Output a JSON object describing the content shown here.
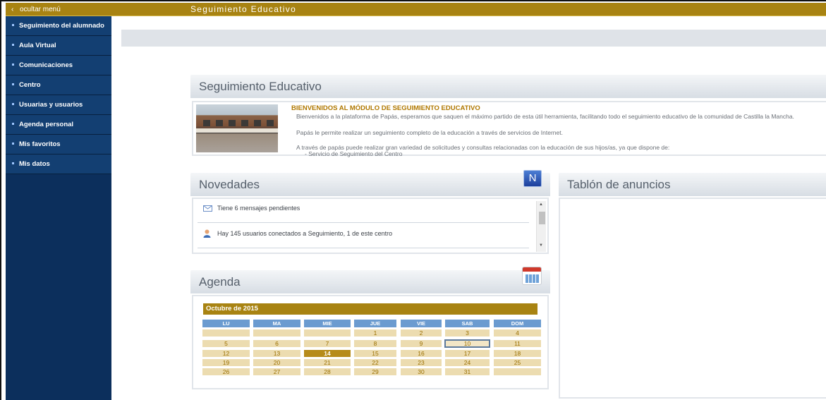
{
  "topbar": {
    "hide_menu_label": "ocultar menú",
    "app_title": "Seguimiento Educativo"
  },
  "sidebar": {
    "items": [
      {
        "label": "Seguimiento del alumnado"
      },
      {
        "label": "Aula Virtual"
      },
      {
        "label": "Comunicaciones"
      },
      {
        "label": "Centro"
      },
      {
        "label": "Usuarias y usuarios"
      },
      {
        "label": "Agenda personal"
      },
      {
        "label": "Mis favoritos"
      },
      {
        "label": "Mis datos"
      }
    ]
  },
  "welcome": {
    "title": "Seguimiento Educativo",
    "heading": "BIENVENIDOS AL MÓDULO DE SEGUIMIENTO EDUCATIVO",
    "p1": "Bienvenidos a la plataforma de Papás, esperamos que saquen el máximo partido de esta útil herramienta, facilitando todo el seguimiento educativo de la comunidad de Castilla la Mancha.",
    "p2": "Papás le permite realizar un seguimiento completo de la educación a través de servicios de Internet.",
    "p3": "A través de papás puede realizar gran variedad de solicitudes y consultas relacionadas con la educación de sus hijos/as, ya que dispone de:",
    "p4": "- Servicio de Seguimiento del Centro"
  },
  "novedades": {
    "title": "Novedades",
    "badge": "N",
    "messages": "Tiene 6 mensajes pendientes",
    "users": "Hay 145 usuarios conectados a Seguimiento, 1 de este centro"
  },
  "tablon": {
    "title": "Tablón de anuncios"
  },
  "agenda": {
    "title": "Agenda",
    "month": "Octubre de 2015",
    "day_headers": [
      "LU",
      "MA",
      "MIE",
      "JUE",
      "VIE",
      "SAB",
      "DOM"
    ],
    "weeks": [
      [
        "",
        "",
        "",
        "1",
        "2",
        "3",
        "4"
      ],
      [
        "5",
        "6",
        "7",
        "8",
        "9",
        "10",
        "11"
      ],
      [
        "12",
        "13",
        "14",
        "15",
        "16",
        "17",
        "18"
      ],
      [
        "19",
        "20",
        "21",
        "22",
        "23",
        "24",
        "25"
      ],
      [
        "26",
        "27",
        "28",
        "29",
        "30",
        "31",
        ""
      ]
    ],
    "today": "14",
    "selected": "10"
  },
  "colors": {
    "accent": "#a88312",
    "sidebar": "#133f72",
    "calendar_header": "#6b9bd0",
    "calendar_cell": "#ecdcb0"
  }
}
